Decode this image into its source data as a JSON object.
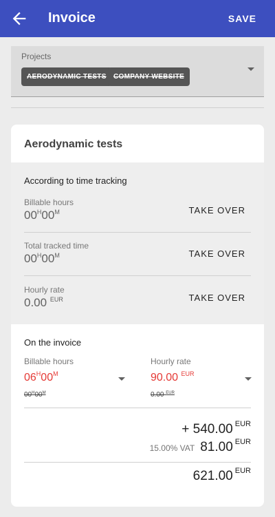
{
  "appbar": {
    "title": "Invoice",
    "save_label": "SAVE",
    "color": "#3d4fbf"
  },
  "projects": {
    "label": "Projects",
    "chips": [
      "AERODYNAMIC TESTS",
      "COMPANY WEBSITE"
    ]
  },
  "card": {
    "title": "Aerodynamic tests",
    "tracking": {
      "heading": "According to time tracking",
      "rows": [
        {
          "label": "Billable hours",
          "value_h": "00",
          "unit_h": "H",
          "value_m": "00",
          "unit_m": "M",
          "action": "TAKE OVER"
        },
        {
          "label": "Total tracked time",
          "value_h": "00",
          "unit_h": "H",
          "value_m": "00",
          "unit_m": "M",
          "action": "TAKE OVER"
        },
        {
          "label": "Hourly rate",
          "value": "0.00",
          "currency": "EUR",
          "action": "TAKE OVER"
        }
      ]
    },
    "invoice": {
      "heading": "On the invoice",
      "billable": {
        "label": "Billable hours",
        "value_h": "06",
        "unit_h": "H",
        "value_m": "00",
        "unit_m": "M",
        "old_h": "00",
        "old_unit_h": "H",
        "old_m": "00",
        "old_unit_m": "M"
      },
      "rate": {
        "label": "Hourly rate",
        "value": "90.00",
        "currency": "EUR",
        "old_value": "0.00",
        "old_currency": "EUR"
      },
      "subtotal": {
        "amount": "+ 540.00",
        "currency": "EUR"
      },
      "vat": {
        "label": "15.00% VAT",
        "amount": "81.00",
        "currency": "EUR"
      },
      "total": {
        "amount": "621.00",
        "currency": "EUR"
      },
      "accent_color": "#e53935"
    }
  }
}
